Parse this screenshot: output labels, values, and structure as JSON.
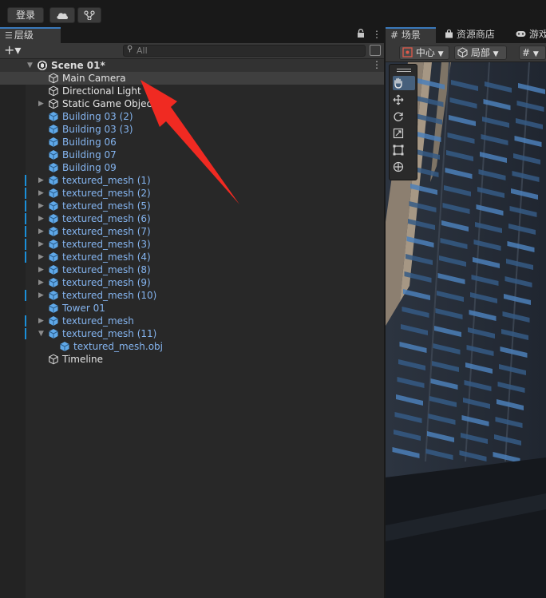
{
  "toolbar": {
    "login_label": "登录",
    "cloud_icon": "cloud-icon",
    "collab_icon": "version-control-icon"
  },
  "hierarchy": {
    "tab_label": "层级",
    "lock_icon": "lock-icon",
    "menu_icon": "kebab-menu-icon",
    "add_label": "+▾",
    "search_placeholder": "All",
    "items": [
      {
        "label": "Scene 01*",
        "kind": "scene",
        "expanded": true
      },
      {
        "label": "Main Camera",
        "color": "white",
        "selected": true
      },
      {
        "label": "Directional Light",
        "color": "white"
      },
      {
        "label": "Static Game Objects",
        "color": "white",
        "foldout": true
      },
      {
        "label": "Building 03 (2)",
        "color": "blue"
      },
      {
        "label": "Building 03 (3)",
        "color": "blue"
      },
      {
        "label": "Building 06",
        "color": "blue"
      },
      {
        "label": "Building 07",
        "color": "blue"
      },
      {
        "label": "Building 09",
        "color": "blue"
      },
      {
        "label": "textured_mesh (1)",
        "color": "blue",
        "foldout": true,
        "modified": true
      },
      {
        "label": "textured_mesh (2)",
        "color": "blue",
        "foldout": true,
        "modified": true
      },
      {
        "label": "textured_mesh (5)",
        "color": "blue",
        "foldout": true,
        "modified": true
      },
      {
        "label": "textured_mesh (6)",
        "color": "blue",
        "foldout": true,
        "modified": true
      },
      {
        "label": "textured_mesh (7)",
        "color": "blue",
        "foldout": true,
        "modified": true
      },
      {
        "label": "textured_mesh (3)",
        "color": "blue",
        "foldout": true,
        "modified": true
      },
      {
        "label": "textured_mesh (4)",
        "color": "blue",
        "foldout": true,
        "modified": true
      },
      {
        "label": "textured_mesh (8)",
        "color": "blue",
        "foldout": true
      },
      {
        "label": "textured_mesh (9)",
        "color": "blue",
        "foldout": true
      },
      {
        "label": "textured_mesh (10)",
        "color": "blue",
        "foldout": true,
        "modified": true
      },
      {
        "label": "Tower 01",
        "color": "blue"
      },
      {
        "label": "textured_mesh",
        "color": "blue",
        "foldout": true,
        "modified": true
      },
      {
        "label": "textured_mesh (11)",
        "color": "blue",
        "foldout": true,
        "expanded": true,
        "modified": true
      },
      {
        "label": "textured_mesh.obj",
        "color": "blue",
        "child": true
      },
      {
        "label": "Timeline",
        "color": "white"
      }
    ]
  },
  "scene_view": {
    "tabs": [
      {
        "label": "场景",
        "icon": "grid-icon",
        "active": true
      },
      {
        "label": "资源商店",
        "icon": "shopping-bag-icon"
      },
      {
        "label": "游戏",
        "icon": "gamepad-icon"
      }
    ],
    "pivot_label": "中心",
    "space_label": "局部",
    "tools": [
      "hand-tool-icon",
      "move-tool-icon",
      "rotate-tool-icon",
      "scale-tool-icon",
      "rect-tool-icon",
      "transform-tool-icon"
    ],
    "active_tool": "hand-tool-icon"
  },
  "colors": {
    "accent": "#3a79bb",
    "prefab_text": "#84b4ef",
    "modified_bar": "#1b8fd9",
    "arrow": "#f02a22"
  }
}
